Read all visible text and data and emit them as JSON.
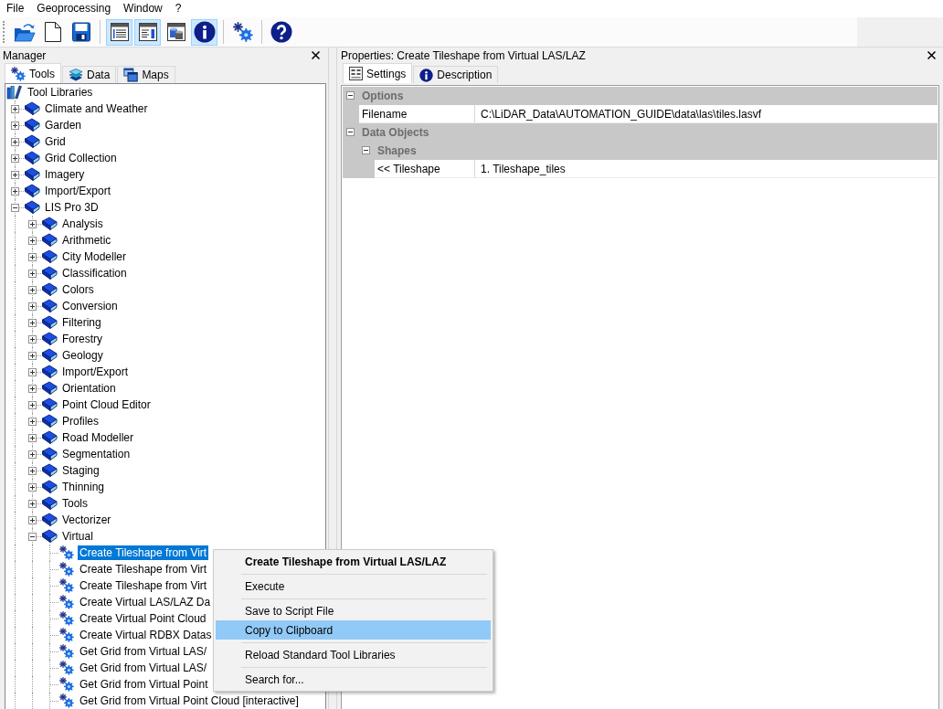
{
  "menu_bar": [
    "File",
    "Geoprocessing",
    "Window",
    "?"
  ],
  "toolbar": {
    "toggles": [
      {
        "selected": true
      },
      {
        "selected": true
      },
      {
        "selected": false
      },
      {
        "selected": true
      }
    ]
  },
  "manager": {
    "title": "Manager",
    "tabs": [
      {
        "label": "Tools",
        "selected": true
      },
      {
        "label": "Data",
        "selected": false
      },
      {
        "label": "Maps",
        "selected": false
      }
    ],
    "tree": {
      "label": "Tool Libraries",
      "kind": "root",
      "selected": false,
      "children": [
        {
          "label": "Climate and Weather",
          "kind": "library",
          "expanded": false,
          "selected": false
        },
        {
          "label": "Garden",
          "kind": "library",
          "expanded": false,
          "selected": false
        },
        {
          "label": "Grid",
          "kind": "library",
          "expanded": false,
          "selected": false
        },
        {
          "label": "Grid Collection",
          "kind": "library",
          "expanded": false,
          "selected": false
        },
        {
          "label": "Imagery",
          "kind": "library",
          "expanded": false,
          "selected": false
        },
        {
          "label": "Import/Export",
          "kind": "library",
          "expanded": false,
          "selected": false
        },
        {
          "label": "LIS Pro 3D",
          "kind": "library",
          "expanded": true,
          "selected": false,
          "children": [
            {
              "label": "Analysis",
              "kind": "library",
              "expanded": false,
              "selected": false
            },
            {
              "label": "Arithmetic",
              "kind": "library",
              "expanded": false,
              "selected": false
            },
            {
              "label": "City Modeller",
              "kind": "library",
              "expanded": false,
              "selected": false
            },
            {
              "label": "Classification",
              "kind": "library",
              "expanded": false,
              "selected": false
            },
            {
              "label": "Colors",
              "kind": "library",
              "expanded": false,
              "selected": false
            },
            {
              "label": "Conversion",
              "kind": "library",
              "expanded": false,
              "selected": false
            },
            {
              "label": "Filtering",
              "kind": "library",
              "expanded": false,
              "selected": false
            },
            {
              "label": "Forestry",
              "kind": "library",
              "expanded": false,
              "selected": false
            },
            {
              "label": "Geology",
              "kind": "library",
              "expanded": false,
              "selected": false
            },
            {
              "label": "Import/Export",
              "kind": "library",
              "expanded": false,
              "selected": false
            },
            {
              "label": "Orientation",
              "kind": "library",
              "expanded": false,
              "selected": false
            },
            {
              "label": "Point Cloud Editor",
              "kind": "library",
              "expanded": false,
              "selected": false
            },
            {
              "label": "Profiles",
              "kind": "library",
              "expanded": false,
              "selected": false
            },
            {
              "label": "Road Modeller",
              "kind": "library",
              "expanded": false,
              "selected": false
            },
            {
              "label": "Segmentation",
              "kind": "library",
              "expanded": false,
              "selected": false
            },
            {
              "label": "Staging",
              "kind": "library",
              "expanded": false,
              "selected": false
            },
            {
              "label": "Thinning",
              "kind": "library",
              "expanded": false,
              "selected": false
            },
            {
              "label": "Tools",
              "kind": "library",
              "expanded": false,
              "selected": false
            },
            {
              "label": "Vectorizer",
              "kind": "library",
              "expanded": false,
              "selected": false
            },
            {
              "label": "Virtual",
              "kind": "library",
              "expanded": true,
              "selected": false,
              "children": [
                {
                  "label": "Create Tileshape from Virt",
                  "kind": "tool",
                  "selected": true
                },
                {
                  "label": "Create Tileshape from Virt",
                  "kind": "tool",
                  "selected": false
                },
                {
                  "label": "Create Tileshape from Virt",
                  "kind": "tool",
                  "selected": false
                },
                {
                  "label": "Create Virtual LAS/LAZ Da",
                  "kind": "tool",
                  "selected": false
                },
                {
                  "label": "Create Virtual Point Cloud",
                  "kind": "tool",
                  "selected": false
                },
                {
                  "label": "Create Virtual RDBX Datas",
                  "kind": "tool",
                  "selected": false
                },
                {
                  "label": "Get Grid from Virtual LAS/",
                  "kind": "tool",
                  "selected": false
                },
                {
                  "label": "Get Grid from Virtual LAS/",
                  "kind": "tool",
                  "selected": false
                },
                {
                  "label": "Get Grid from Virtual Point",
                  "kind": "tool",
                  "selected": false
                },
                {
                  "label": "Get Grid from Virtual Point Cloud [interactive]",
                  "kind": "tool",
                  "selected": false
                }
              ]
            }
          ]
        }
      ]
    }
  },
  "properties": {
    "title": "Properties: Create Tileshape from Virtual LAS/LAZ",
    "tabs": [
      {
        "label": "Settings",
        "selected": true
      },
      {
        "label": "Description",
        "selected": false
      }
    ],
    "grid": [
      {
        "kind": "group",
        "label": "Options",
        "expanded": true,
        "children": [
          {
            "kind": "field",
            "label": "Filename",
            "value": "C:\\LiDAR_Data\\AUTOMATION_GUIDE\\data\\las\\tiles.lasvf"
          }
        ]
      },
      {
        "kind": "group",
        "label": "Data Objects",
        "expanded": true,
        "children": [
          {
            "kind": "group",
            "label": "Shapes",
            "expanded": true,
            "children": [
              {
                "kind": "field",
                "label": "<< Tileshape",
                "value": "1. Tileshape_tiles"
              }
            ]
          }
        ]
      }
    ]
  },
  "context_menu": {
    "items": [
      {
        "kind": "default",
        "label": "Create Tileshape from Virtual LAS/LAZ",
        "selected": false
      },
      {
        "kind": "separator"
      },
      {
        "kind": "item",
        "label": "Execute",
        "selected": false
      },
      {
        "kind": "separator"
      },
      {
        "kind": "item",
        "label": "Save to Script File",
        "selected": false
      },
      {
        "kind": "item",
        "label": "Copy to Clipboard",
        "selected": true
      },
      {
        "kind": "separator"
      },
      {
        "kind": "item",
        "label": "Reload Standard Tool Libraries",
        "selected": false
      },
      {
        "kind": "separator"
      },
      {
        "kind": "item",
        "label": "Search for...",
        "selected": false
      }
    ]
  }
}
